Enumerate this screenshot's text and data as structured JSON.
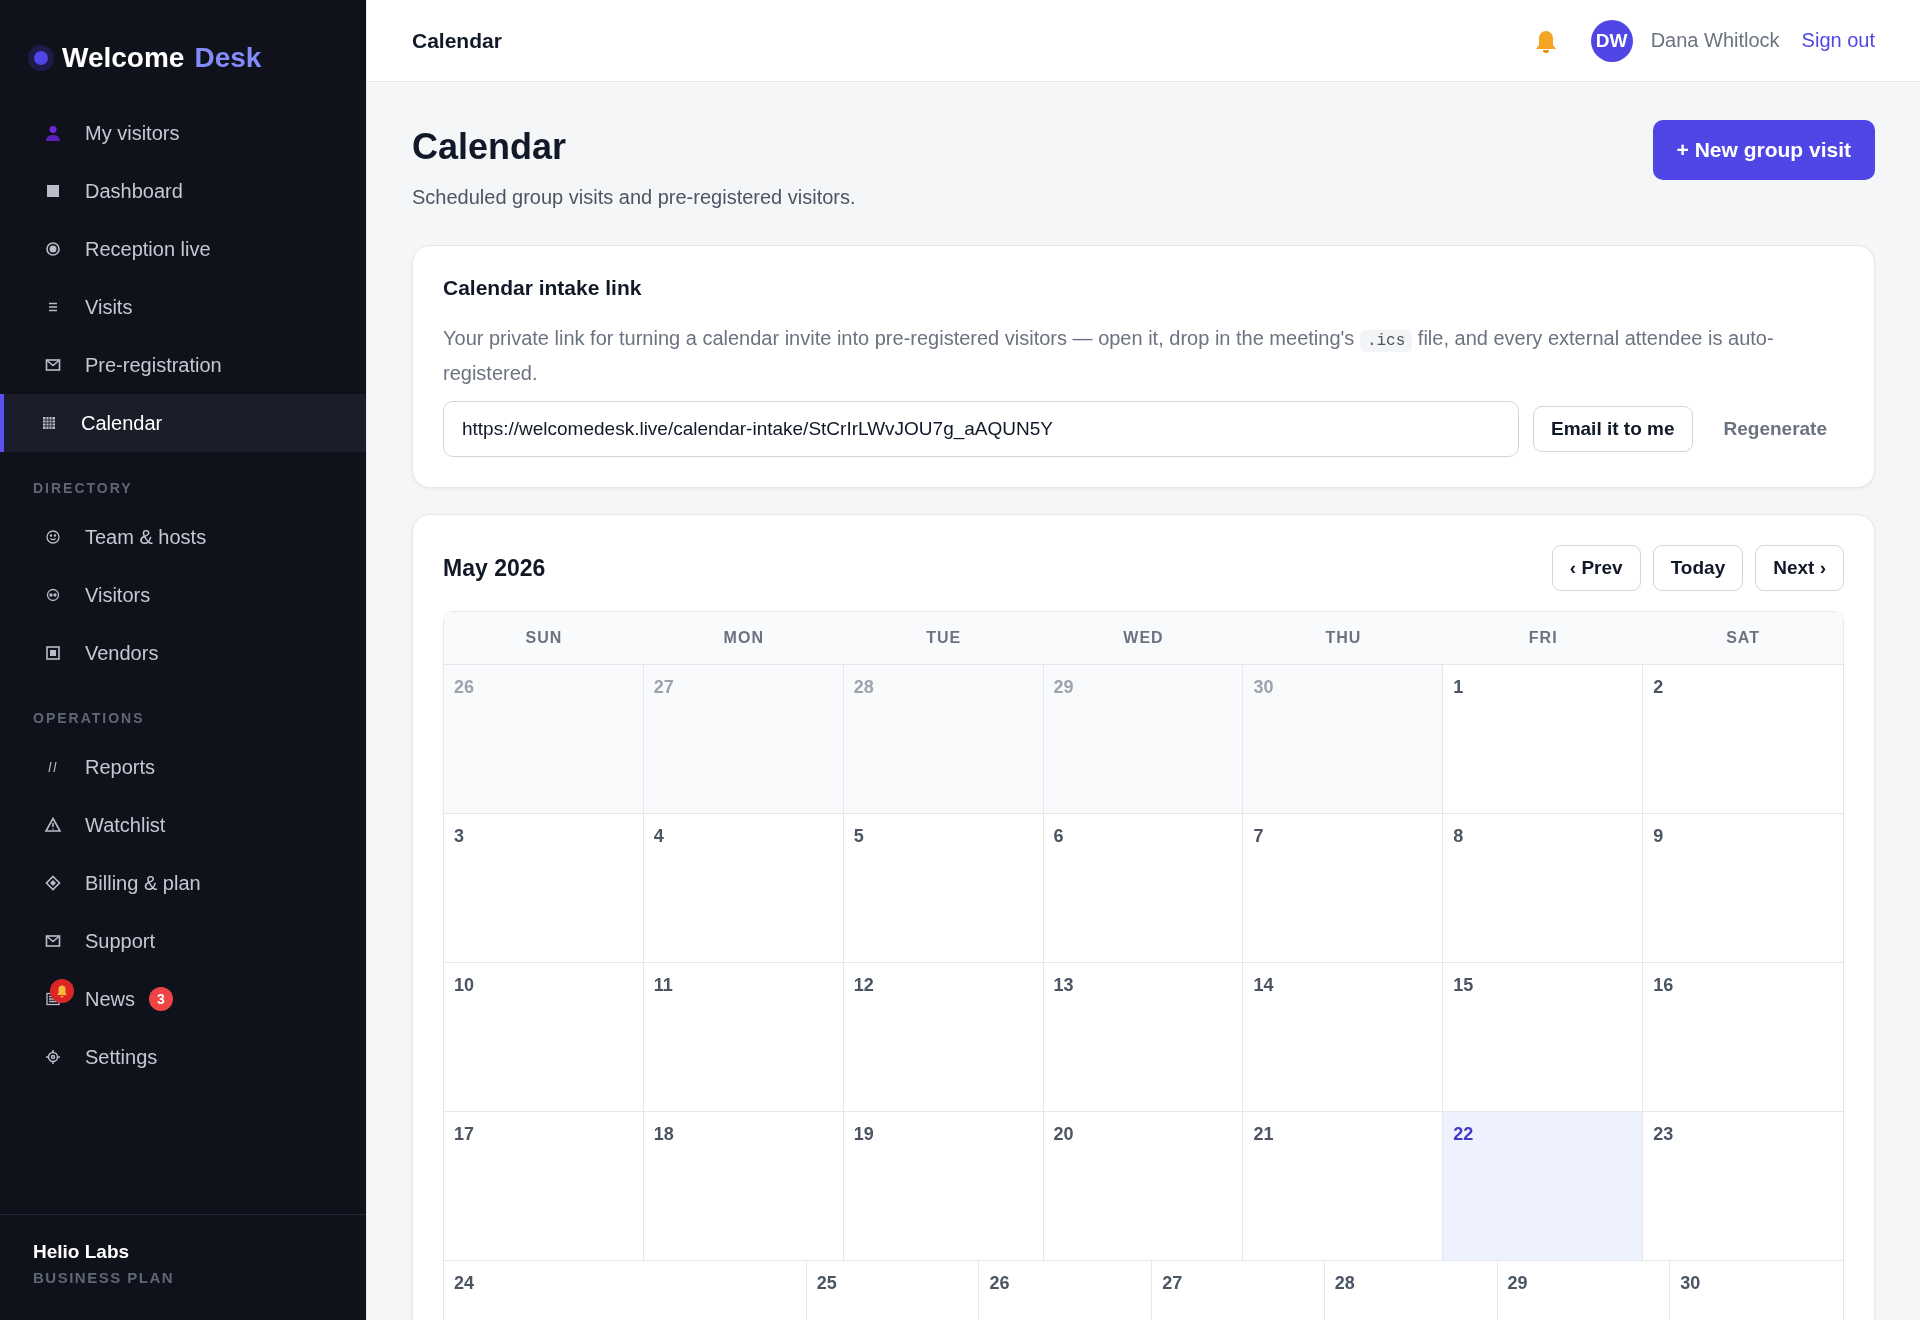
{
  "sidebar": {
    "brand": {
      "first": "Welcome",
      "second": "Desk"
    },
    "sections": [
      {
        "items": [
          {
            "label": "My visitors",
            "selected": false
          },
          {
            "label": "Dashboard",
            "selected": false
          },
          {
            "label": "Reception live",
            "selected": false
          },
          {
            "label": "Visits",
            "selected": false
          },
          {
            "label": "Pre-registration",
            "selected": false
          },
          {
            "label": "Calendar",
            "selected": true
          }
        ]
      },
      {
        "heading": "DIRECTORY",
        "items": [
          {
            "label": "Team & hosts",
            "selected": false
          },
          {
            "label": "Visitors",
            "selected": false
          },
          {
            "label": "Vendors",
            "selected": false
          }
        ]
      },
      {
        "heading": "OPERATIONS",
        "items": [
          {
            "label": "Reports",
            "selected": false
          },
          {
            "label": "Watchlist",
            "selected": false
          },
          {
            "label": "Billing & plan",
            "selected": false
          },
          {
            "label": "Support",
            "selected": false
          },
          {
            "label": "News",
            "selected": false,
            "badge": "3"
          },
          {
            "label": "Settings",
            "selected": false
          }
        ]
      }
    ],
    "org": {
      "name": "Helio Labs",
      "plan": "BUSINESS PLAN"
    }
  },
  "topbar": {
    "title": "Calendar",
    "initials": "DW",
    "user": "Dana Whitlock",
    "sign_out": "Sign out"
  },
  "page": {
    "title": "Calendar",
    "subtitle": "Scheduled group visits and pre-registered visitors.",
    "primary_button": "+ New group visit"
  },
  "intake": {
    "title": "Calendar intake link",
    "text_before": "Your private link for turning a calendar invite into pre-registered visitors — open it, drop in the meeting's",
    "code": ".ics",
    "text_after": "file, and every external attendee is auto-registered.",
    "link": "https://welcomedesk.live/calendar-intake/StCrIrLWvJOU7g_aAQUN5Y",
    "email_button": "Email it to me",
    "regenerate_button": "Regenerate"
  },
  "calendar": {
    "month": "May 2026",
    "prev": "‹ Prev",
    "today_button": "Today",
    "next": "Next ›",
    "weekdays": [
      "SUN",
      "MON",
      "TUE",
      "WED",
      "THU",
      "FRI",
      "SAT"
    ],
    "weeks": [
      [
        {
          "day": "26",
          "muted": true,
          "today": false
        },
        {
          "day": "27",
          "muted": true,
          "today": false
        },
        {
          "day": "28",
          "muted": true,
          "today": false
        },
        {
          "day": "29",
          "muted": true,
          "today": false
        },
        {
          "day": "30",
          "muted": true,
          "today": false
        },
        {
          "day": "1",
          "muted": false,
          "today": false
        },
        {
          "day": "2",
          "muted": false,
          "today": false
        }
      ],
      [
        {
          "day": "3",
          "muted": false,
          "today": false
        },
        {
          "day": "4",
          "muted": false,
          "today": false
        },
        {
          "day": "5",
          "muted": false,
          "today": false
        },
        {
          "day": "6",
          "muted": false,
          "today": false
        },
        {
          "day": "7",
          "muted": false,
          "today": false
        },
        {
          "day": "8",
          "muted": false,
          "today": false
        },
        {
          "day": "9",
          "muted": false,
          "today": false
        }
      ],
      [
        {
          "day": "10",
          "muted": false,
          "today": false
        },
        {
          "day": "11",
          "muted": false,
          "today": false
        },
        {
          "day": "12",
          "muted": false,
          "today": false
        },
        {
          "day": "13",
          "muted": false,
          "today": false
        },
        {
          "day": "14",
          "muted": false,
          "today": false
        },
        {
          "day": "15",
          "muted": false,
          "today": false
        },
        {
          "day": "16",
          "muted": false,
          "today": false
        }
      ],
      [
        {
          "day": "17",
          "muted": false,
          "today": false
        },
        {
          "day": "18",
          "muted": false,
          "today": false
        },
        {
          "day": "19",
          "muted": false,
          "today": false
        },
        {
          "day": "20",
          "muted": false,
          "today": false
        },
        {
          "day": "21",
          "muted": false,
          "today": false
        },
        {
          "day": "22",
          "muted": false,
          "today": true
        },
        {
          "day": "23",
          "muted": false,
          "today": false
        }
      ],
      [
        {
          "day": "24",
          "muted": false,
          "today": false
        },
        {
          "day": "25",
          "muted": false,
          "today": false
        },
        {
          "day": "26",
          "muted": false,
          "today": false
        },
        {
          "day": "27",
          "muted": false,
          "today": false
        },
        {
          "day": "28",
          "muted": false,
          "today": false
        },
        {
          "day": "29",
          "muted": false,
          "today": false
        },
        {
          "day": "30",
          "muted": false,
          "today": false
        }
      ]
    ]
  }
}
